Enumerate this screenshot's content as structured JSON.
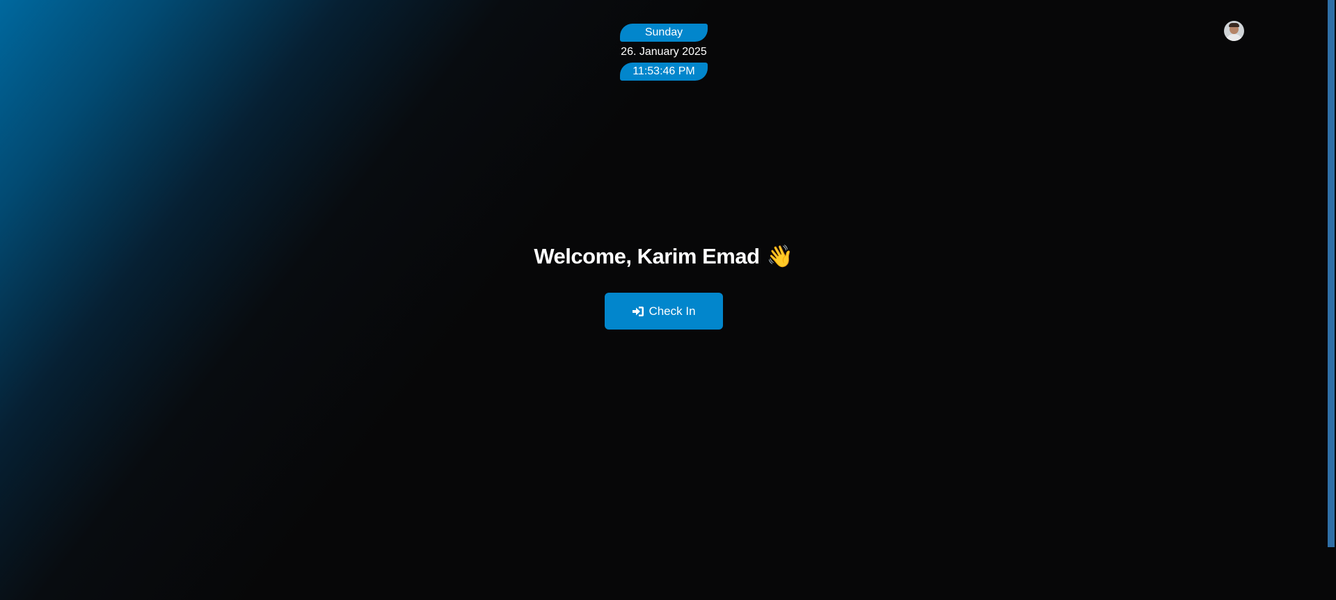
{
  "clock": {
    "day": "Sunday",
    "date": "26. January 2025",
    "time": "11:53:46 PM"
  },
  "user": {
    "avatar_icon": "user-avatar",
    "greeting": "Welcome, Karim Emad",
    "greeting_emoji": "👋"
  },
  "actions": {
    "check_in_label": "Check In",
    "check_in_icon": "sign-in-icon"
  },
  "colors": {
    "accent": "#0286cc",
    "gradient_start": "#00689e",
    "background": "#070708",
    "scrollbar": "#2f6fa6",
    "text": "#ffffff"
  }
}
